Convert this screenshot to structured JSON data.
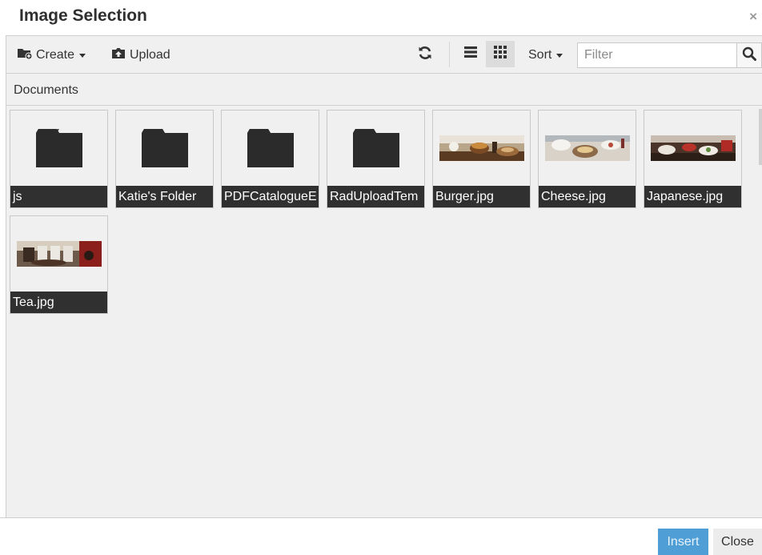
{
  "dialog": {
    "title": "Image Selection",
    "close_glyph": "×"
  },
  "toolbar": {
    "create_label": "Create",
    "upload_label": "Upload",
    "sort_label": "Sort",
    "filter_placeholder": "Filter",
    "filter_value": "",
    "active_view": "thumbnails",
    "icons": {
      "create": "new-folder-icon",
      "upload": "upload-icon",
      "refresh": "refresh-icon",
      "list_view": "list-view-icon",
      "grid_view": "grid-view-icon",
      "search": "search-icon"
    }
  },
  "breadcrumb": {
    "current": "Documents"
  },
  "items": [
    {
      "name": "js",
      "type": "folder"
    },
    {
      "name": "Katie's Folder",
      "type": "folder"
    },
    {
      "name": "PDFCatalogueE",
      "type": "folder"
    },
    {
      "name": "RadUploadTem",
      "type": "folder"
    },
    {
      "name": "Burger.jpg",
      "type": "image"
    },
    {
      "name": "Cheese.jpg",
      "type": "image"
    },
    {
      "name": "Japanese.jpg",
      "type": "image"
    },
    {
      "name": "Tea.jpg",
      "type": "image"
    }
  ],
  "footer": {
    "insert_label": "Insert",
    "close_label": "Close"
  },
  "colors": {
    "insert_button": "#4f9fd6",
    "tile_label_bg": "#303030",
    "panel_bg": "#f0f0f0"
  }
}
